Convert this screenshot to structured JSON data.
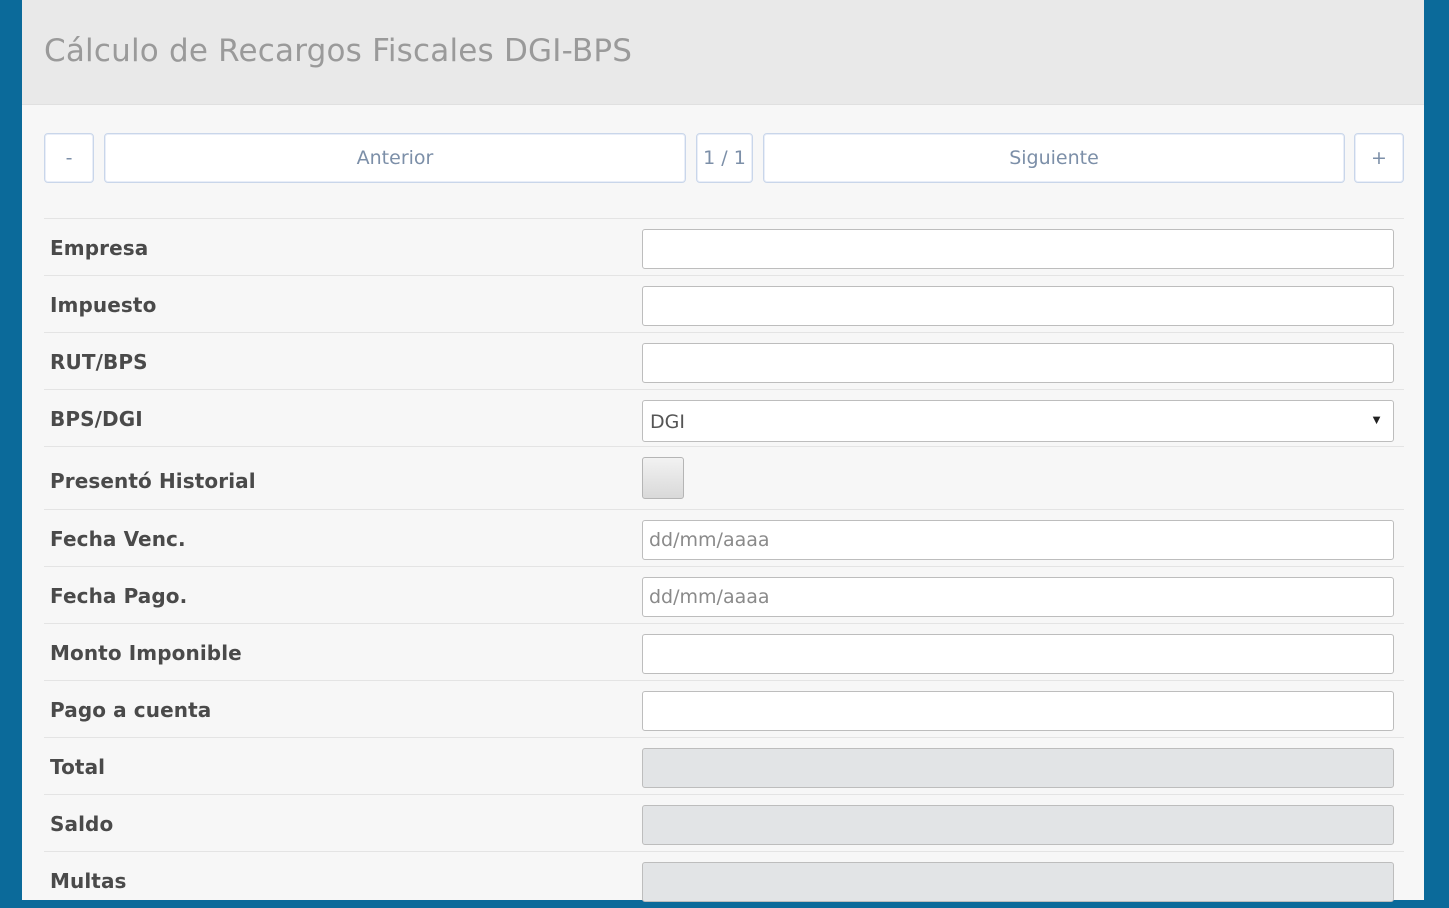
{
  "header": {
    "title": "Cálculo de Recargos Fiscales DGI-BPS"
  },
  "pager": {
    "minus": "-",
    "prev": "Anterior",
    "position": "1 / 1",
    "next": "Siguiente",
    "plus": "+"
  },
  "form": {
    "empresa": {
      "label": "Empresa",
      "value": ""
    },
    "impuesto": {
      "label": "Impuesto",
      "value": ""
    },
    "rut_bps": {
      "label": "RUT/BPS",
      "value": ""
    },
    "bps_dgi": {
      "label": "BPS/DGI",
      "value": "DGI",
      "caret": "▼"
    },
    "presento_historial": {
      "label": "Presentó Historial",
      "checked": false
    },
    "fecha_venc": {
      "label": "Fecha Venc.",
      "placeholder": "dd/mm/aaaa"
    },
    "fecha_pago": {
      "label": "Fecha Pago.",
      "placeholder": "dd/mm/aaaa"
    },
    "monto_imponible": {
      "label": "Monto Imponible",
      "value": ""
    },
    "pago_a_cuenta": {
      "label": "Pago a cuenta",
      "value": ""
    },
    "total": {
      "label": "Total",
      "value": ""
    },
    "saldo": {
      "label": "Saldo",
      "value": ""
    },
    "multas": {
      "label": "Multas",
      "value": ""
    }
  }
}
